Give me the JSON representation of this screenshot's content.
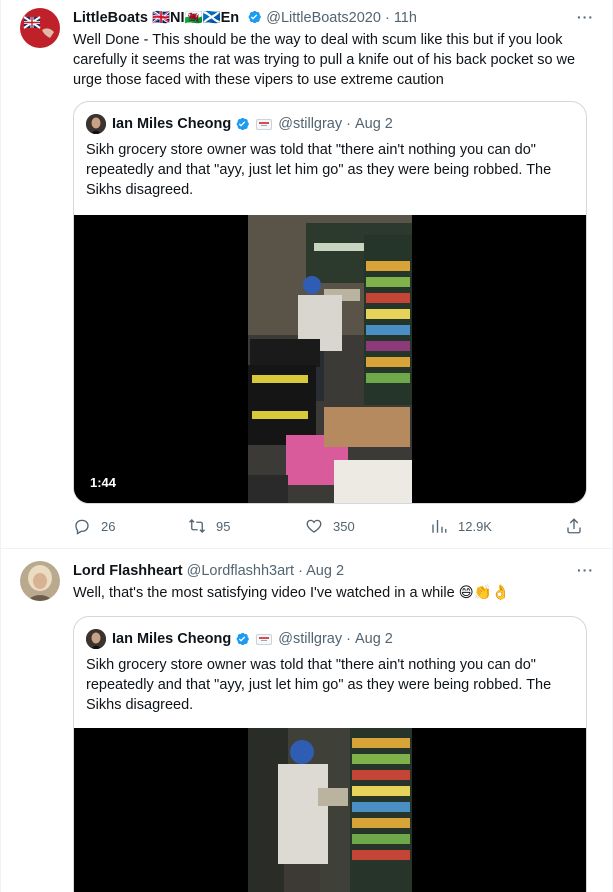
{
  "tweets": [
    {
      "author_name": "LittleBoats 🇬🇧NI🏴󠁧󠁢󠁷󠁬󠁳󠁿🏴󠁧󠁢󠁳󠁣󠁴󠁿En",
      "handle": "@LittleBoats2020",
      "time": "11h",
      "text": "Well Done - This should be the way to deal with scum like this but if you look carefully it seems the rat was trying to pull a knife out of his back pocket so we urge those faced with these vipers to use extreme caution",
      "quote": {
        "author_name": "Ian Miles Cheong",
        "handle": "@stillgray",
        "time": "Aug 2",
        "text": "Sikh grocery store owner was told that \"there ain't nothing you can do\" repeatedly and that \"ayy, just let him go\" as they were being robbed. The Sikhs disagreed.",
        "video_duration": "1:44"
      },
      "stats": {
        "replies": "26",
        "retweets": "95",
        "likes": "350",
        "views": "12.9K"
      }
    },
    {
      "author_name": "Lord Flashheart",
      "handle": "@Lordflashh3art",
      "time": "Aug 2",
      "text": "Well, that's the most satisfying video I've watched in a while 😄👏👌",
      "quote": {
        "author_name": "Ian Miles Cheong",
        "handle": "@stillgray",
        "time": "Aug 2",
        "text": "Sikh grocery store owner was told that \"there ain't nothing you can do\" repeatedly and that \"ayy, just let him go\" as they were being robbed. The Sikhs disagreed."
      }
    }
  ],
  "ui": {
    "more_label": "···",
    "separator": "·"
  },
  "colors": {
    "text_primary": "#0f1419",
    "text_secondary": "#536471",
    "verified_blue": "#1d9bf0",
    "border": "#cfd9de"
  },
  "icons": [
    "more-icon",
    "verified-icon",
    "flag-icon",
    "reply-icon",
    "retweet-icon",
    "like-icon",
    "views-icon",
    "share-icon"
  ]
}
